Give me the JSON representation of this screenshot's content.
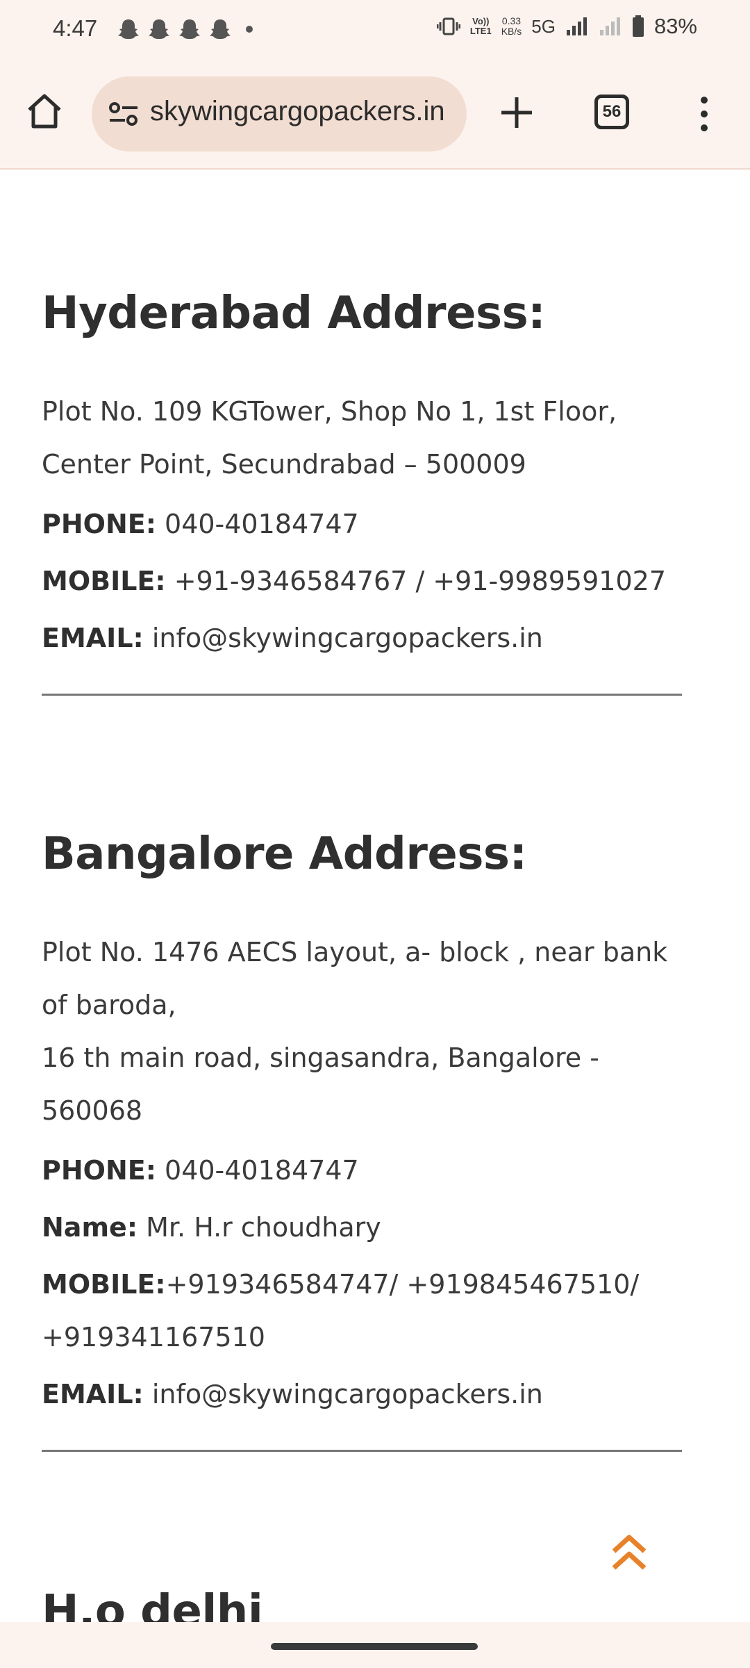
{
  "status_bar": {
    "time": "4:47",
    "notification_icons": [
      "snapchat-icon",
      "snapchat-icon",
      "snapchat-icon",
      "snapchat-icon"
    ],
    "lte_label_top": "Vo))",
    "lte_label_bottom": "LTE1",
    "speed_value": "0.33",
    "speed_unit": "KB/s",
    "network": "5G",
    "battery": "83%"
  },
  "browser": {
    "url": "skywingcargopackers.in",
    "tab_count": "56"
  },
  "hyderabad": {
    "heading": "Hyderabad Address:",
    "address": "Plot No. 109 KGTower, Shop No 1, 1st Floor, Center Point, Secundrabad – 500009",
    "phone_label": "PHONE:",
    "phone": "040-40184747",
    "mobile_label": "MOBILE:",
    "mobile": "+91-9346584767 / +91-9989591027",
    "email_label": "EMAIL:",
    "email": "info@skywingcargopackers.in"
  },
  "bangalore": {
    "heading": "Bangalore Address:",
    "address_line1": "Plot No. 1476 AECS layout, a- block , near bank of baroda,",
    "address_line2": "16 th main road, singasandra, Bangalore - 560068",
    "phone_label": "PHONE:",
    "phone": "040-40184747",
    "name_label": "Name:",
    "name": "Mr. H.r choudhary",
    "mobile_label": "MOBILE:",
    "mobile": "+919346584747/ +919845467510/ +919341167510",
    "email_label": "EMAIL:",
    "email": "info@skywingcargopackers.in"
  },
  "next_section": {
    "heading": "H.o delhi"
  },
  "colors": {
    "chrome_bg": "#fdf3ee",
    "urlbar_bg": "#f2ddd2",
    "text": "#2f2f2f",
    "scroll_top_accent": "#e8822a"
  }
}
